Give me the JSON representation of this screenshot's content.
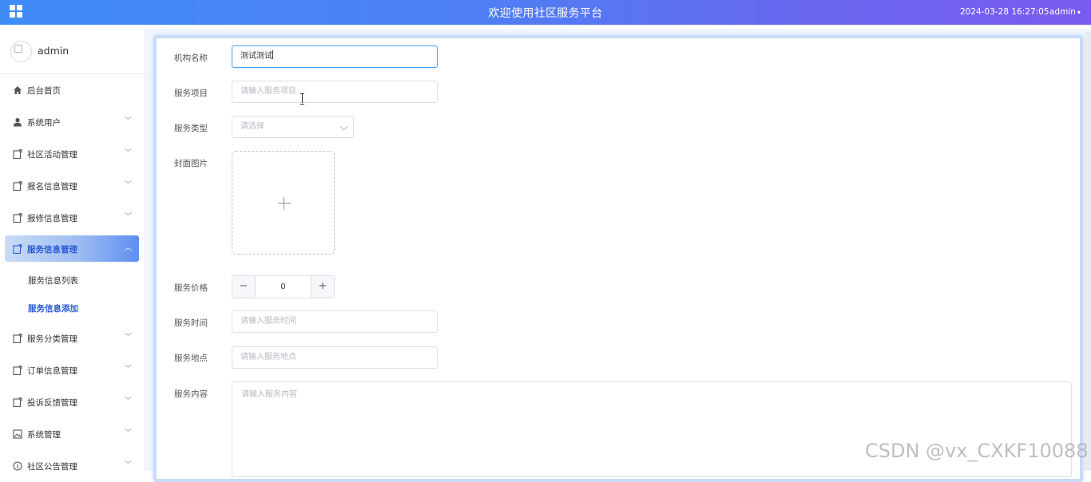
{
  "header": {
    "title": "欢迎使用社区服务平台",
    "datetime": "2024-03-28 16:27:05",
    "user": "admin",
    "menu_icon": "grid-icon",
    "background_colors": [
      "#3f8cf7",
      "#7a5af0"
    ]
  },
  "sidebar": {
    "profile_name": "admin",
    "items": [
      {
        "label": "后台首页",
        "icon": "home-icon"
      },
      {
        "label": "系统用户",
        "icon": "user-icon"
      },
      {
        "label": "社区活动管理",
        "icon": "document-icon"
      },
      {
        "label": "报名信息管理",
        "icon": "document-icon"
      },
      {
        "label": "报修信息管理",
        "icon": "document-icon"
      },
      {
        "label": "服务信息管理",
        "icon": "document-icon",
        "active": true
      },
      {
        "label": "服务分类管理",
        "icon": "document-icon"
      },
      {
        "label": "订单信息管理",
        "icon": "document-icon"
      },
      {
        "label": "投诉反馈管理",
        "icon": "document-icon"
      },
      {
        "label": "系统管理",
        "icon": "picture-icon"
      },
      {
        "label": "社区公告管理",
        "icon": "info-icon"
      }
    ],
    "submenu": [
      {
        "label": "服务信息列表"
      },
      {
        "label": "服务信息添加",
        "current": true
      }
    ],
    "active_color": "#2a5bd7"
  },
  "form": {
    "org_name": {
      "label": "机构名称",
      "value": "测试测试"
    },
    "service_item": {
      "label": "服务项目",
      "placeholder": "请输入服务项目"
    },
    "service_type": {
      "label": "服务类型",
      "placeholder": "请选择"
    },
    "cover_image": {
      "label": "封面图片"
    },
    "price": {
      "label": "服务价格",
      "value": "0",
      "minus": "−",
      "plus": "+"
    },
    "service_time": {
      "label": "服务时间",
      "placeholder": "请输入服务时间"
    },
    "service_place": {
      "label": "服务地点",
      "placeholder": "请输入服务地点"
    },
    "service_content": {
      "label": "服务内容",
      "placeholder": "请输入服务内容"
    }
  },
  "watermark": "CSDN @vx_CXKF10088"
}
